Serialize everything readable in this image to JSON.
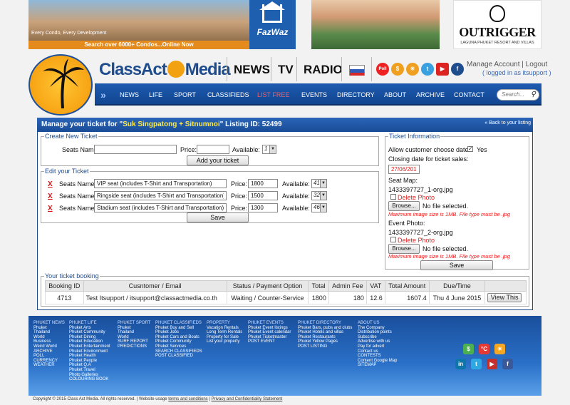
{
  "ads": {
    "fazwaz_tagline": "Every Condo, Every Development",
    "fazwaz_bar": "Search over 6000+ Condos...Online Now",
    "fazwaz_logo": "FazWaz",
    "outrigger_logo": "OUTRIGGER",
    "outrigger_sub": "LAGUNA PHUKET RESORT AND VILLAS"
  },
  "header": {
    "logo_left": "ClassAct",
    "logo_right": "Media",
    "links": [
      "NEWS",
      "TV",
      "RADIO"
    ],
    "social_icons": [
      "poll-icon",
      "currency-icon",
      "weather-icon",
      "twitter-icon",
      "youtube-icon",
      "facebook-icon"
    ],
    "account": "Manage Account | Logout",
    "logged_in": "( logged in as itsupport )"
  },
  "nav": {
    "items": [
      "NEWS",
      "LIFE",
      "SPORT",
      "CLASSIFIEDS",
      "LIST FREE",
      "EVENTS",
      "DIRECTORY",
      "ABOUT",
      "ARCHIVE",
      "CONTACT"
    ],
    "active": "LIST FREE",
    "search_placeholder": "Search..."
  },
  "main": {
    "title_prefix": "Manage your ticket for \"",
    "listing_name": "Suk Singpatong + Sitnumnoi",
    "title_suffix": "\" Listing ID: 52499",
    "back_link": "« Back to your listing",
    "create": {
      "legend": "Create New Ticket",
      "seats_label": "Seats Name:",
      "price_label": "Price:",
      "available_label": "Available:",
      "available_value": "1",
      "button": "Add your ticket"
    },
    "edit": {
      "legend": "Edit your Ticket",
      "seats_label": "Seats Name:",
      "price_label": "Price:",
      "available_label": "Available:",
      "delete": "X",
      "rows": [
        {
          "name": "VIP seat (includes T-Shirt and Transportation)",
          "price": "1800",
          "available": "41"
        },
        {
          "name": "Ringside seat (includes T-Shirt and Transportation)",
          "price": "1500",
          "available": "32"
        },
        {
          "name": "Stadium seat (includes T-Shirt and Transportation)",
          "price": "1300",
          "available": "46"
        }
      ],
      "button": "Save"
    },
    "info": {
      "legend": "Ticket Information",
      "choose_label": "Allow customer choose date:",
      "choose_value": "Yes",
      "closing_label": "Closing date for ticket sales:",
      "closing_value": "27/06/2015",
      "seat_map_label": "Seat Map:",
      "seat_map_file": "1433397727_1-org.jpg",
      "event_photo_label": "Event Photo:",
      "event_photo_file": "1433397727_2-org.jpg",
      "delete_photo": "Delete Photo",
      "browse": "Browse...",
      "no_file": "No file selected.",
      "max_note": "Maximum image size is 1MB. File type must be .jpg",
      "button": "Save"
    },
    "booking": {
      "legend": "Your ticket booking",
      "headers": [
        "Booking ID",
        "Cusntomer / Email",
        "Status / Payment Option",
        "Total",
        "Admin Fee",
        "VAT",
        "Total Amount",
        "Due/Time"
      ],
      "rows": [
        {
          "id": "4713",
          "customer": "Test Itsupport / itsupport@classactmedia.co.th",
          "status": "Waiting / Counter-Service",
          "total": "1800",
          "fee": "180",
          "vat": "12.6",
          "amount": "1607.4",
          "date": "Thu 4 June 2015",
          "action": "View This"
        }
      ]
    }
  },
  "footer": {
    "cols": [
      [
        "PHUKET NEWS",
        "Phuket",
        "Thailand",
        "World",
        "Business",
        "Weird World",
        "ARCHIVE",
        "POLL",
        "CURRENCY",
        "WEATHER"
      ],
      [
        "PHUKET LIFE",
        "Phuket Arts",
        "Phuket Community",
        "Phuket Dining",
        "Phuket Education",
        "Phuket Entertainment",
        "Phuket Environment",
        "Phuket Health",
        "Phuket People",
        "Phuket Q.A",
        "Phuket Travel",
        "Photo Galleries",
        "COLOURING BOOK"
      ],
      [
        "PHUKET SPORT",
        "Phuket",
        "Thailand",
        "World",
        "SURF REPORT",
        "PREDICTIONS"
      ],
      [
        "PHUKET CLASSIFIEDS",
        "Phuket Buy and Sell",
        "Phuket Jobs",
        "Phuket Cars and Boats",
        "Phuket Community",
        "Phuket Services",
        "SEARCH CLASSIFIEDS",
        "POST CLASSIFIED"
      ],
      [
        "PROPERTY",
        "Vacation Rentals",
        "Long Term Rentals",
        "Property for Sale",
        "List your property"
      ],
      [
        "PHUKET EVENTS",
        "Phuket Event listings",
        "Phuket Event calendar",
        "Phuket Ticketmaster",
        "POST EVENT"
      ],
      [
        "PHUKET DIRECTORY",
        "Phuket Bars, pubs and clubs",
        "Phuket Hotels and villas",
        "Phuket Restaurants",
        "Phuket Yellow Pages",
        "POST LISTING"
      ],
      [
        "ABOUT US",
        "The Company",
        "Distribution points",
        "Subscribe",
        "Advertise with us",
        "Pay for advert",
        "Contact us",
        "CONTESTS",
        "Content Google Map",
        "SITEMAP"
      ]
    ],
    "copyright": "Copyright © 2015 Class Act Media. All rights reserved. | Website usage",
    "terms": "terms and conditions",
    "privacy": "Privacy and Confidentiality Statement",
    "colors": {
      "bg": "#1a4f9c",
      "accent": "#f2a111"
    }
  }
}
